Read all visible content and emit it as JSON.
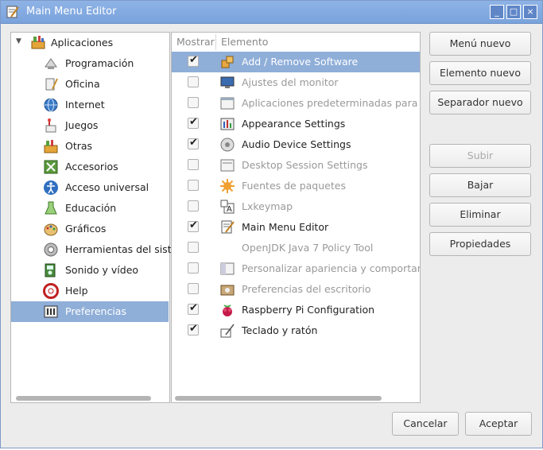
{
  "window": {
    "title": "Main Menu Editor",
    "minimize": "_",
    "maximize": "□",
    "close": "×"
  },
  "sidebar": {
    "root": {
      "label": "Aplicaciones",
      "icon": "applications-icon"
    },
    "items": [
      {
        "label": "Programación",
        "icon": "programming-icon"
      },
      {
        "label": "Oficina",
        "icon": "office-icon"
      },
      {
        "label": "Internet",
        "icon": "internet-icon"
      },
      {
        "label": "Juegos",
        "icon": "games-icon"
      },
      {
        "label": "Otras",
        "icon": "other-icon"
      },
      {
        "label": "Accesorios",
        "icon": "accessories-icon"
      },
      {
        "label": "Acceso universal",
        "icon": "accessibility-icon"
      },
      {
        "label": "Educación",
        "icon": "education-icon"
      },
      {
        "label": "Gráficos",
        "icon": "graphics-icon"
      },
      {
        "label": "Herramientas del sistema",
        "icon": "system-tools-icon"
      },
      {
        "label": "Sonido y vídeo",
        "icon": "sound-video-icon"
      },
      {
        "label": "Help",
        "icon": "help-icon"
      },
      {
        "label": "Preferencias",
        "icon": "preferences-icon",
        "selected": true
      }
    ]
  },
  "list": {
    "columns": {
      "show": "Mostrar",
      "item": "Elemento"
    },
    "items": [
      {
        "label": "Add / Remove Software",
        "checked": true,
        "selected": true,
        "icon": "package-icon"
      },
      {
        "label": "Ajustes del monitor",
        "checked": false,
        "icon": "monitor-icon"
      },
      {
        "label": "Aplicaciones predeterminadas para LXSession",
        "checked": false,
        "icon": "window-icon"
      },
      {
        "label": "Appearance Settings",
        "checked": true,
        "icon": "appearance-icon"
      },
      {
        "label": "Audio Device Settings",
        "checked": true,
        "icon": "audio-icon"
      },
      {
        "label": "Desktop Session Settings",
        "checked": false,
        "icon": "session-icon"
      },
      {
        "label": "Fuentes de paquetes",
        "checked": false,
        "icon": "sources-icon"
      },
      {
        "label": "Lxkeymap",
        "checked": false,
        "icon": "keymap-icon"
      },
      {
        "label": "Main Menu Editor",
        "checked": true,
        "icon": "menu-editor-icon"
      },
      {
        "label": "OpenJDK Java 7 Policy Tool",
        "checked": false,
        "icon": "blank-icon"
      },
      {
        "label": "Personalizar apariencia y comportamiento",
        "checked": false,
        "icon": "customize-icon"
      },
      {
        "label": "Preferencias del escritorio",
        "checked": false,
        "icon": "desktop-prefs-icon"
      },
      {
        "label": "Raspberry Pi Configuration",
        "checked": true,
        "icon": "raspberry-icon"
      },
      {
        "label": "Teclado y ratón",
        "checked": true,
        "icon": "keyboard-mouse-icon"
      }
    ]
  },
  "buttons": {
    "new_menu": "Menú nuevo",
    "new_item": "Elemento nuevo",
    "new_separator": "Separador nuevo",
    "up": "Subir",
    "down": "Bajar",
    "delete": "Eliminar",
    "properties": "Propiedades",
    "cancel": "Cancelar",
    "accept": "Aceptar"
  },
  "colors": {
    "titlebar": "#7ea7df",
    "selection": "#8faed8"
  }
}
